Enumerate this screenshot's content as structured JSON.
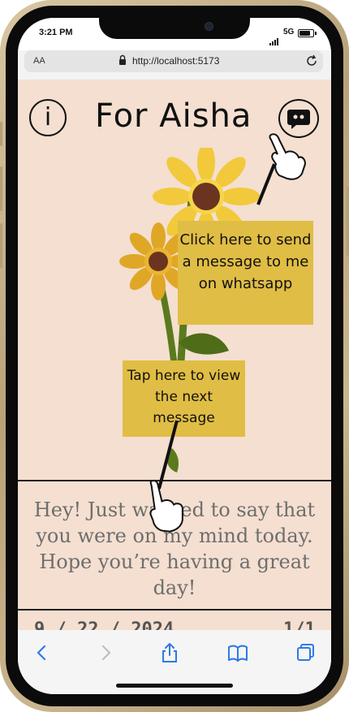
{
  "status": {
    "time": "3:21 PM",
    "network": "5G"
  },
  "browser": {
    "text_size_label": "AA",
    "url": "http://localhost:5173"
  },
  "page": {
    "title": "For Aisha",
    "info_glyph": "i",
    "tooltips": {
      "whatsapp": "Click here to send a message to me on whatsapp",
      "next": "Tap here to view the next message"
    },
    "message": "Hey! Just wanted to say that you were on my mind today. Hope you’re having a great day!",
    "date": "9 / 22 / 2024",
    "counter": "1/1"
  },
  "colors": {
    "page_background": "#f4dfd0",
    "tooltip": "#e0bd44",
    "sunflower_petal": "#f2c93b",
    "sunflower_center": "#6b3420",
    "stem": "#5b7a1e"
  },
  "icons": [
    "info-icon",
    "chat-icon",
    "lock-icon",
    "reload-icon",
    "back-icon",
    "forward-icon",
    "share-icon",
    "bookmarks-icon",
    "tabs-icon",
    "pointing-hand-icon"
  ]
}
